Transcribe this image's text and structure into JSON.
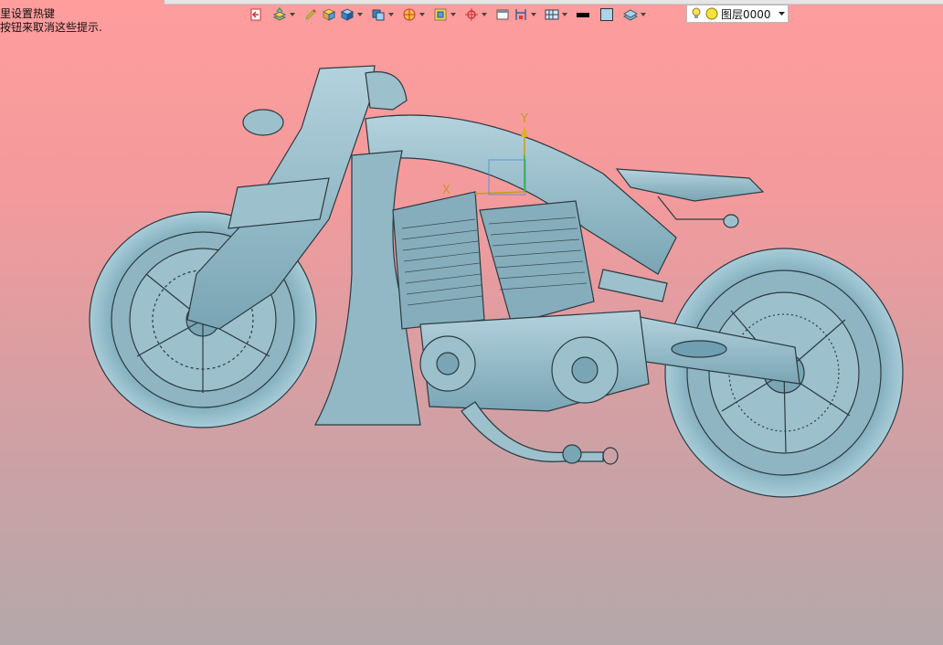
{
  "hint": {
    "line1": "里设置热键",
    "line2": "按钮来取消这些提示."
  },
  "toolbar": {
    "icons": [
      "import-icon",
      "layer-stack-icon",
      "pencil-icon",
      "solid-box-icon",
      "shaded-cube-icon",
      "view-cube-icon",
      "section-disk-icon",
      "frame-icon",
      "target-icon",
      "window-icon",
      "dimension-icon",
      "screen-grid-icon",
      "line-style-icon",
      "color-swatch-icon",
      "layer-plane-icon"
    ],
    "layer_selector": {
      "value": "图层0000",
      "icons": [
        "bulb-icon",
        "yellow-circle-icon"
      ]
    }
  },
  "viewport": {
    "background_top": "#ff9d9d",
    "background_bottom": "#b4a8aa",
    "model_color": "#8fb5c2",
    "axis": {
      "y_label": "Y",
      "x_label": "X"
    }
  }
}
